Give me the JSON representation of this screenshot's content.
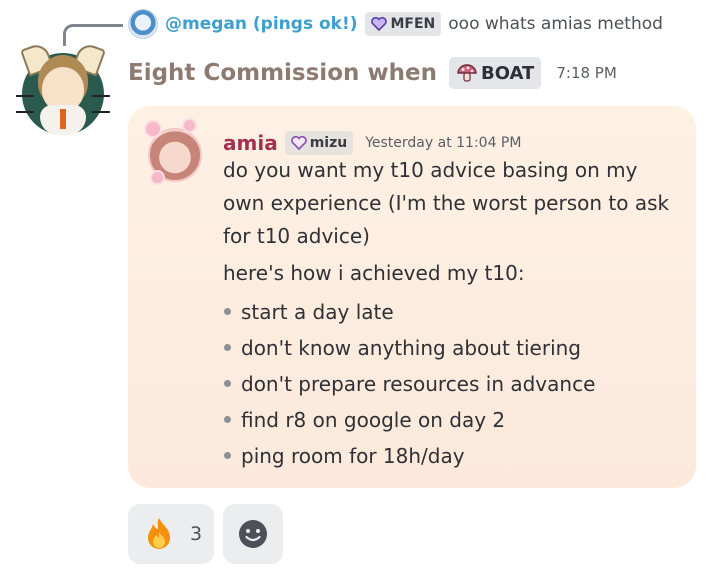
{
  "reply": {
    "author": "@megan (pings ok!)",
    "tag": "MFEN",
    "text": "ooo whats amias method",
    "avatar_icon": "megan-avatar-icon",
    "tag_icon": "heart-icon"
  },
  "message": {
    "author": "Eight Commission when",
    "tag": "BOAT",
    "tag_icon": "mushroom-icon",
    "timestamp": "7:18 PM",
    "avatar_icon": "cat-ear-avatar-icon"
  },
  "forward": {
    "author": "amia",
    "tag": "mizu",
    "tag_icon": "heart-icon",
    "timestamp": "Yesterday at 11:04 PM",
    "paragraphs": [
      "do you want my t10 advice basing on my own experience (I'm the worst person to ask for t10 advice)",
      "here's how i achieved my t10:"
    ],
    "list": [
      "start a day late",
      "don't know anything about tiering",
      "don't prepare resources in advance",
      "find r8 on google on day 2",
      "ping room for 18h/day"
    ]
  },
  "reactions": [
    {
      "icon": "fire-icon",
      "count": "3"
    }
  ],
  "add_reaction_icon": "add-reaction-icon",
  "colors": {
    "reply_name": "#3d9fcf",
    "author_name": "#8d7b72",
    "forward_name": "#a2304f",
    "card_bg": "#fdf1e4",
    "tag_bg": "#e3e5e8",
    "reaction_bg": "#ebedef"
  }
}
